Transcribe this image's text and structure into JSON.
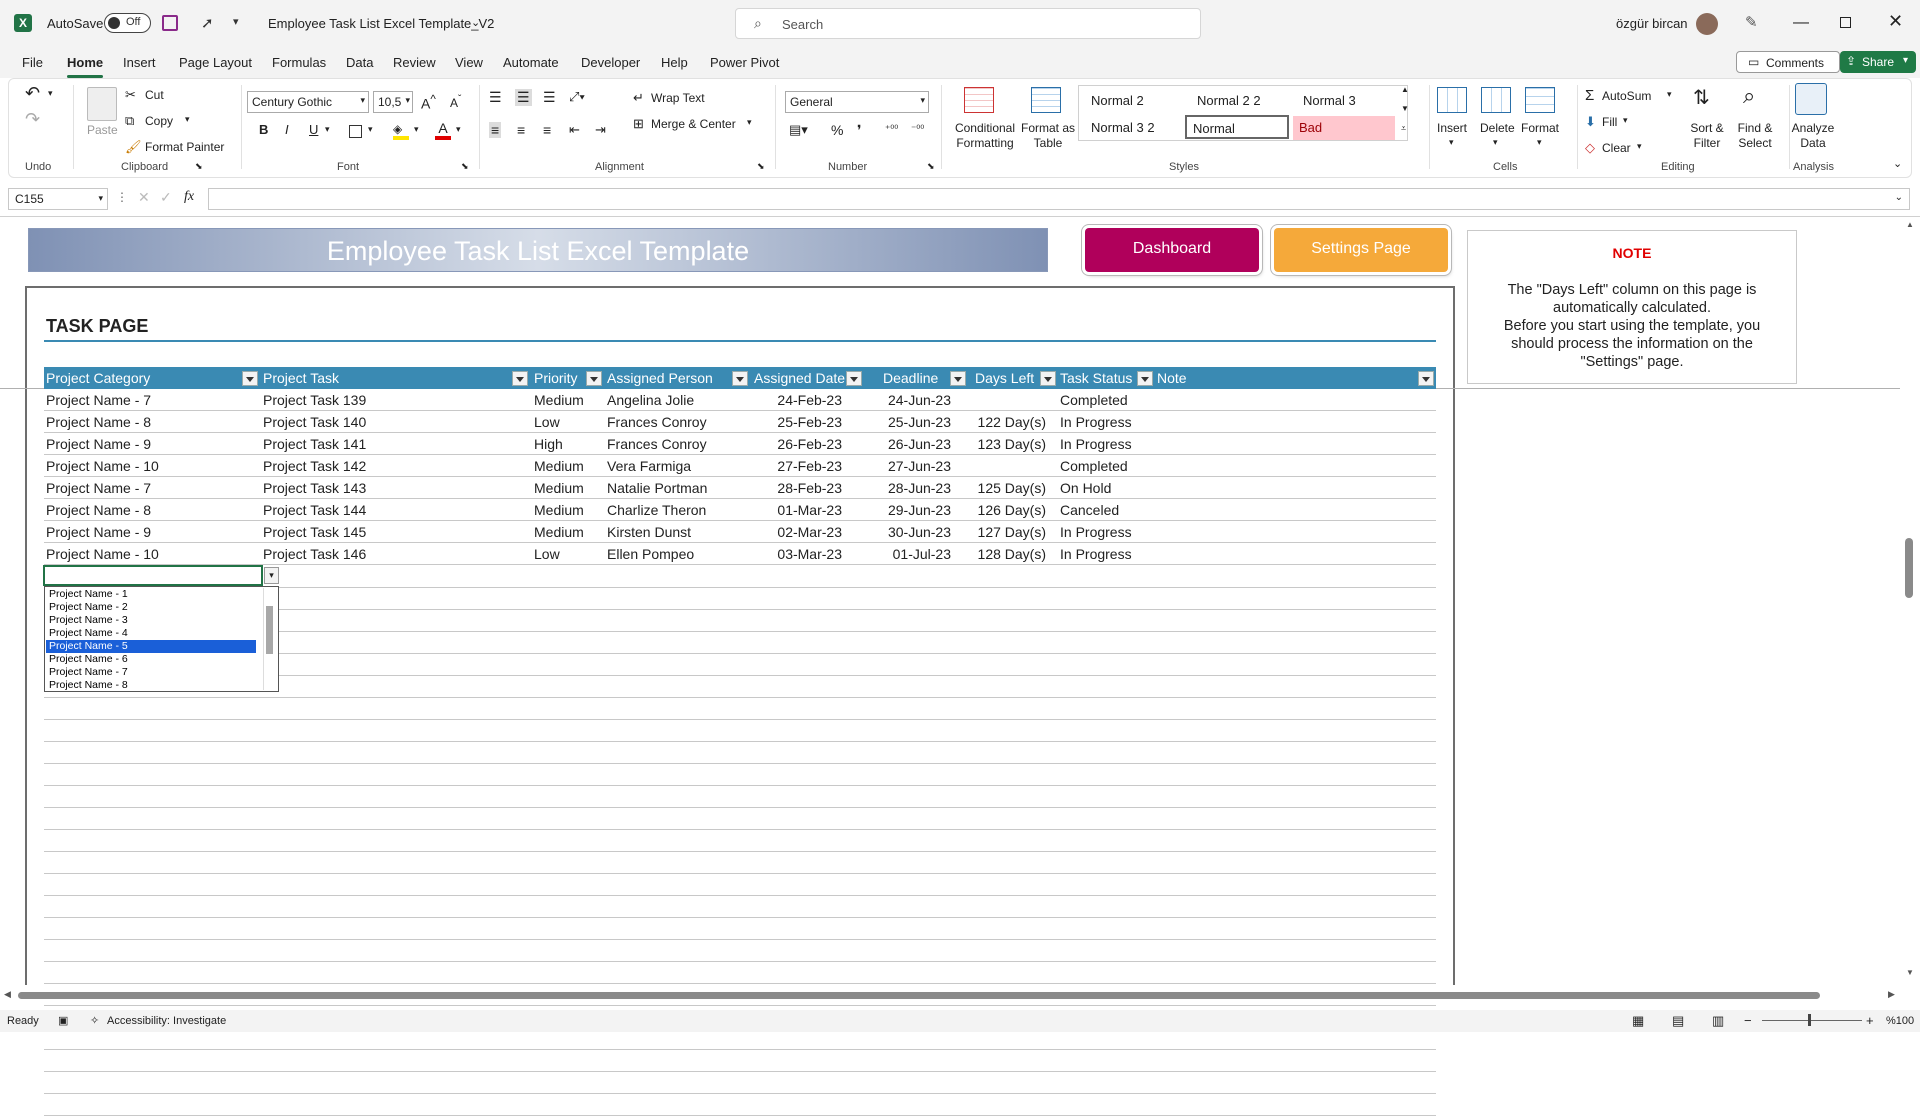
{
  "titlebar": {
    "autosave_label": "AutoSave",
    "autosave_state": "Off",
    "file_name": "Employee Task List Excel Template_V2",
    "search_placeholder": "Search",
    "user_name": "özgür bircan",
    "colors": {
      "excel_green": "#217346"
    }
  },
  "menu": {
    "tabs": [
      "File",
      "Home",
      "Insert",
      "Page Layout",
      "Formulas",
      "Data",
      "Review",
      "View",
      "Automate",
      "Developer",
      "Help",
      "Power Pivot"
    ],
    "active_tab": "Home",
    "comments_label": "Comments",
    "share_label": "Share"
  },
  "ribbon": {
    "undo_group": "Undo",
    "clipboard": {
      "paste": "Paste",
      "cut": "Cut",
      "copy": "Copy",
      "format_painter": "Format Painter",
      "group": "Clipboard"
    },
    "font": {
      "family": "Century Gothic",
      "size": "10,5",
      "bold": "B",
      "italic": "I",
      "underline": "U",
      "group": "Font"
    },
    "alignment": {
      "wrap_text": "Wrap Text",
      "merge_center": "Merge & Center",
      "group": "Alignment"
    },
    "number": {
      "format": "General",
      "group": "Number"
    },
    "styles": {
      "conditional": "Conditional Formatting",
      "format_table": "Format as Table",
      "cells": [
        "Normal 2",
        "Normal 2 2",
        "Normal 3",
        "Normal 3 2",
        "Normal",
        "Bad"
      ],
      "group": "Styles"
    },
    "cells": {
      "insert": "Insert",
      "delete": "Delete",
      "format": "Format",
      "group": "Cells"
    },
    "editing": {
      "autosum": "AutoSum",
      "fill": "Fill",
      "clear": "Clear",
      "sort_filter": "Sort & Filter",
      "find_select": "Find & Select",
      "group": "Editing"
    },
    "analysis": {
      "analyze": "Analyze Data",
      "group": "Analysis"
    }
  },
  "formula_bar": {
    "name_box": "C155",
    "fx": "fx",
    "content": ""
  },
  "sheet": {
    "banner_title": "Employee Task List Excel Template",
    "dashboard_button": "Dashboard",
    "settings_button": "Settings Page",
    "colors": {
      "dashboard": "#b0005b",
      "settings": "#f5a93a",
      "header": "#3a8ab3"
    },
    "note": {
      "title": "NOTE",
      "lines": [
        "The \"Days Left\" column on this page is",
        "automatically calculated.",
        "Before you start using the template, you",
        "should process the information on the",
        "\"Settings\" page."
      ]
    },
    "section_title": "TASK PAGE",
    "columns": [
      "Project Category",
      "Project Task",
      "Priority",
      "Assigned Person",
      "Assigned Date",
      "Deadline",
      "Days Left",
      "Task Status",
      "Note"
    ],
    "rows": [
      [
        "Project Name - 7",
        "Project Task 139",
        "Medium",
        "Angelina Jolie",
        "24-Feb-23",
        "24-Jun-23",
        "",
        "Completed",
        ""
      ],
      [
        "Project Name - 8",
        "Project Task 140",
        "Low",
        "Frances Conroy",
        "25-Feb-23",
        "25-Jun-23",
        "122 Day(s)",
        "In Progress",
        ""
      ],
      [
        "Project Name - 9",
        "Project Task 141",
        "High",
        "Frances Conroy",
        "26-Feb-23",
        "26-Jun-23",
        "123 Day(s)",
        "In Progress",
        ""
      ],
      [
        "Project Name - 10",
        "Project Task 142",
        "Medium",
        "Vera Farmiga",
        "27-Feb-23",
        "27-Jun-23",
        "",
        "Completed",
        ""
      ],
      [
        "Project Name - 7",
        "Project Task 143",
        "Medium",
        "Natalie Portman",
        "28-Feb-23",
        "28-Jun-23",
        "125 Day(s)",
        "On Hold",
        ""
      ],
      [
        "Project Name - 8",
        "Project Task 144",
        "Medium",
        "Charlize Theron",
        "01-Mar-23",
        "29-Jun-23",
        "126 Day(s)",
        "Canceled",
        ""
      ],
      [
        "Project Name - 9",
        "Project Task 145",
        "Medium",
        "Kirsten Dunst",
        "02-Mar-23",
        "30-Jun-23",
        "127 Day(s)",
        "In Progress",
        ""
      ],
      [
        "Project Name - 10",
        "Project Task 146",
        "Low",
        "Ellen Pompeo",
        "03-Mar-23",
        "01-Jul-23",
        "128 Day(s)",
        "In Progress",
        ""
      ]
    ],
    "dropdown": {
      "options": [
        "Project Name - 1",
        "Project Name - 2",
        "Project Name - 3",
        "Project Name - 4",
        "Project Name - 5",
        "Project Name - 6",
        "Project Name - 7",
        "Project Name - 8"
      ],
      "selected_index": 4
    }
  },
  "status": {
    "ready": "Ready",
    "accessibility": "Accessibility: Investigate",
    "zoom": "%100"
  }
}
